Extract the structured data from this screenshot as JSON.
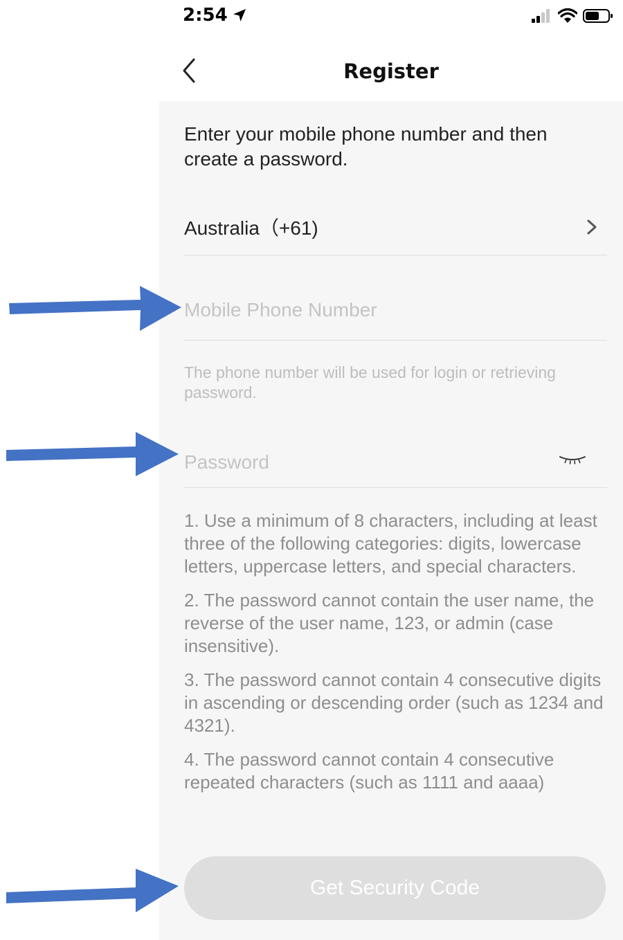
{
  "status_bar": {
    "time": "2:54",
    "icons": [
      "location-arrow-icon",
      "cellular-signal-icon",
      "wifi-icon",
      "battery-icon"
    ]
  },
  "nav": {
    "title": "Register",
    "back_icon": "chevron-left-icon"
  },
  "form": {
    "intro": "Enter your mobile phone number and then create a password.",
    "country": {
      "label": "Australia（+61)",
      "icon": "chevron-right-icon"
    },
    "phone": {
      "placeholder": "Mobile Phone Number",
      "value": "",
      "hint": "The phone number will be used for login or retrieving password."
    },
    "password": {
      "placeholder": "Password",
      "value": "",
      "toggle_icon": "eye-closed-icon"
    },
    "rules": [
      "1. Use a minimum of 8 characters, including at least three of the following categories: digits, lowercase letters, uppercase letters, and special characters.",
      "2. The password cannot contain the user name, the reverse of the user name, 123, or admin (case insensitive).",
      "3. The password cannot contain 4 consecutive digits in ascending or descending order (such as 1234 and 4321).",
      "4. The password cannot contain 4 consecutive repeated characters (such as 1111 and aaaa)"
    ],
    "submit_label": "Get Security Code"
  },
  "annotations": {
    "arrow_color": "#4472c4",
    "arrows": [
      "arrow-icon",
      "arrow-icon",
      "arrow-icon"
    ]
  },
  "colors": {
    "page_background": "#f6f6f6",
    "button_disabled": "#dedede",
    "placeholder": "#c4c4c4"
  }
}
